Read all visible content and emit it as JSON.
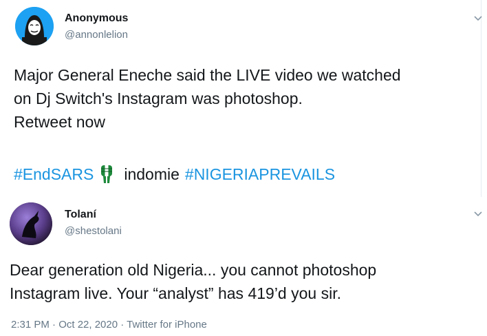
{
  "tweet1": {
    "name": "Anonymous",
    "handle": "@annonlelion",
    "text": "Major General Eneche said the LIVE video we watched\non Dj Switch's Instagram was photoshop.\nRetweet now",
    "tag1": "#EndSARS",
    "plain": "indomie",
    "tag2": "#NIGERIAPREVAILS",
    "avatar_icon": "anonymous-mask-icon",
    "emoji_icon": "raised-fist-green-white-icon"
  },
  "tweet2": {
    "name": "Tolaní",
    "handle": "@shestolani",
    "text": "Dear generation old Nigeria... you cannot photoshop\nInstagram live. Your “analyst” has 419’d you sir.",
    "timestamp": "2:31 PM · Oct 22, 2020 · Twitter for iPhone"
  },
  "colors": {
    "accent": "#1b95e0",
    "secondary_text": "#657786"
  }
}
